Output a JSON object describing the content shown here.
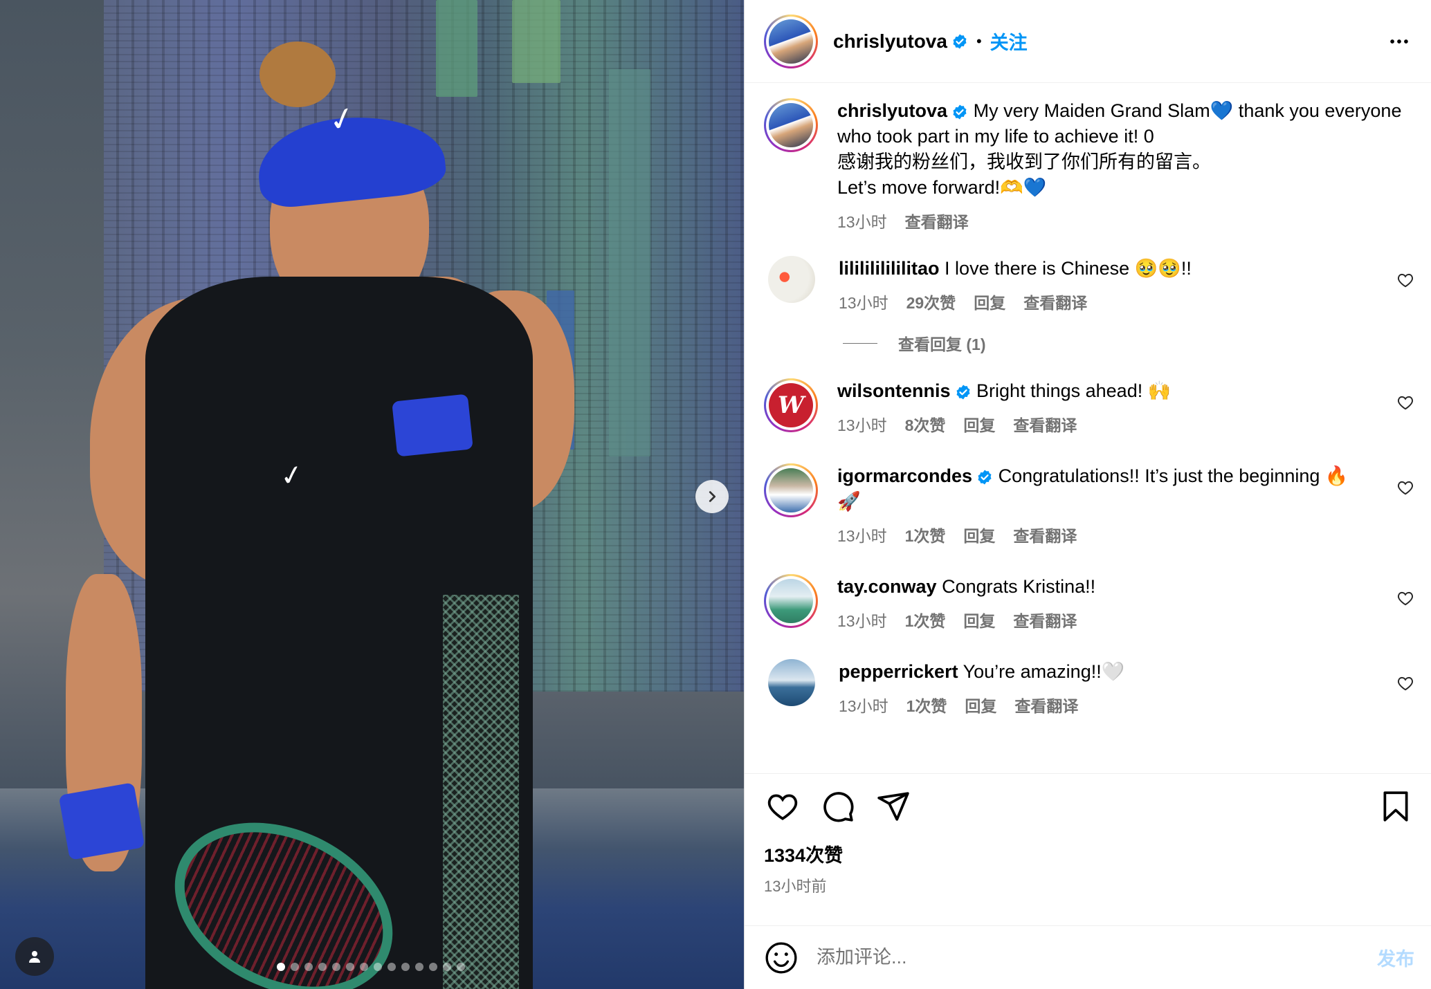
{
  "post": {
    "author": "chrislyutova",
    "follow_label": "关注",
    "bullet": "•",
    "caption_parts": {
      "text1": "My very Maiden Grand Slam💙 thank you everyone who took part in my life to achieve it! 0",
      "text2": "感谢我的粉丝们，我收到了你们所有的留言。",
      "text3": "Let’s move forward!🫶💙"
    },
    "caption_time": "13小时",
    "caption_translate": "查看翻译",
    "likes": "1334次赞",
    "time_ago": "13小时前"
  },
  "comments": [
    {
      "user": "lililililililitao",
      "text": "I love there is Chinese 🥹🥹!!",
      "time": "13小时",
      "likes": "29次赞",
      "reply": "回复",
      "translate": "查看翻译",
      "verified": false,
      "view_replies": "查看回复 (1)"
    },
    {
      "user": "wilsontennis",
      "text": "Bright things ahead! 🙌",
      "time": "13小时",
      "likes": "8次赞",
      "reply": "回复",
      "translate": "查看翻译",
      "verified": true
    },
    {
      "user": "igormarcondes",
      "text": "Congratulations!! It’s just the beginning 🔥🚀",
      "time": "13小时",
      "likes": "1次赞",
      "reply": "回复",
      "translate": "查看翻译",
      "verified": true
    },
    {
      "user": "tay.conway",
      "text": "Congrats Kristina!!",
      "time": "13小时",
      "likes": "1次赞",
      "reply": "回复",
      "translate": "查看翻译",
      "verified": false
    },
    {
      "user": "pepperrickert",
      "text": "You’re amazing!!🤍",
      "time": "13小时",
      "likes": "1次赞",
      "reply": "回复",
      "translate": "查看翻译",
      "verified": false
    }
  ],
  "composer": {
    "placeholder": "添加评论...",
    "post_label": "发布"
  },
  "media": {
    "slide_count": 14,
    "active_slide": 1
  },
  "colors": {
    "accent": "#0095f6",
    "verified": "#0095f6",
    "muted": "#737373",
    "post_disabled": "#b3dbff"
  },
  "icons": {
    "verified": "verified-badge-icon",
    "more": "more-options-icon",
    "like": "heart-icon",
    "comment": "comment-icon",
    "share": "share-icon",
    "save": "bookmark-icon",
    "emoji": "emoji-icon",
    "next": "chevron-right-icon",
    "tag": "user-tag-icon"
  }
}
